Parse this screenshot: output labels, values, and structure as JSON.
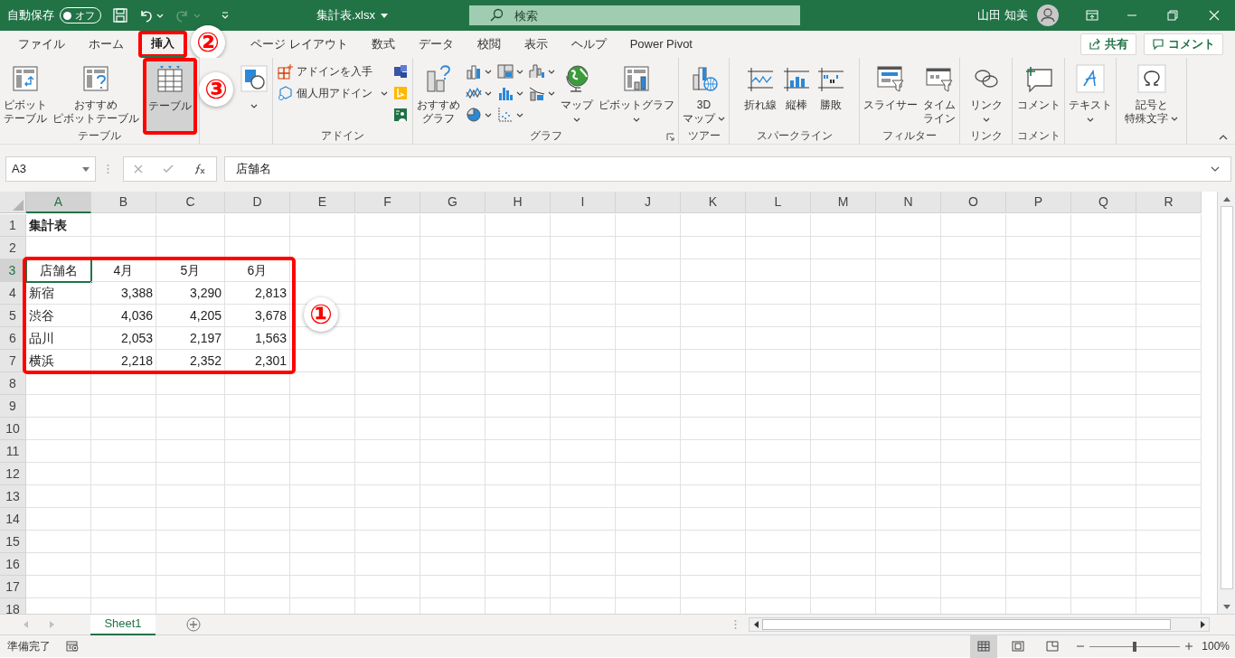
{
  "title_bar": {
    "autosave_label": "自動保存",
    "autosave_toggle": {
      "label": "オフ",
      "on": false
    },
    "redo_disabled": true,
    "file_name": "集計表.xlsx",
    "search_placeholder": "検索",
    "user_name": "山田 知美"
  },
  "ribbon_tabs": [
    {
      "label": "ファイル",
      "selected": false
    },
    {
      "label": "ホーム",
      "selected": false
    },
    {
      "label": "挿入",
      "selected": true
    },
    {
      "label": "ページ レイアウト",
      "selected": false
    },
    {
      "label": "数式",
      "selected": false
    },
    {
      "label": "データ",
      "selected": false
    },
    {
      "label": "校閲",
      "selected": false
    },
    {
      "label": "表示",
      "selected": false
    },
    {
      "label": "ヘルプ",
      "selected": false
    },
    {
      "label": "Power Pivot",
      "selected": false
    }
  ],
  "share_button": "共有",
  "comment_button": "コメント",
  "ribbon_groups": [
    {
      "label": "テーブル",
      "columns": [
        {
          "kind": "large",
          "lines": [
            "ピボット",
            "テーブル"
          ],
          "dropdown": false,
          "hovered": false
        },
        {
          "kind": "large",
          "lines": [
            "おすすめ",
            "ピボットテーブル"
          ],
          "dropdown": false,
          "hovered": false
        },
        {
          "kind": "large",
          "lines": [
            "テーブル"
          ],
          "dropdown": false,
          "hovered": true
        }
      ]
    },
    {
      "columns": [
        {
          "kind": "large",
          "dropdown": true,
          "hovered": false
        }
      ]
    },
    {
      "label": "アドイン",
      "columns": [
        {
          "kind": "stack",
          "items": [
            {
              "text": "アドインを入手",
              "dropdown": false
            },
            {
              "text": "個人用アドイン",
              "dropdown": true
            }
          ]
        },
        {
          "kind": "stack",
          "items": [
            {
              "dropdown": false
            },
            {
              "dropdown": false
            },
            {
              "dropdown": false
            }
          ]
        }
      ]
    },
    {
      "label": "グラフ",
      "launcher": true,
      "columns": [
        {
          "kind": "large",
          "lines": [
            "おすすめ",
            "グラフ"
          ],
          "dropdown": false,
          "hovered": false
        },
        {
          "kind": "stack",
          "items": [
            {
              "dropdown": true
            },
            {
              "dropdown": true
            },
            {
              "dropdown": true
            }
          ]
        },
        {
          "kind": "stack",
          "items": [
            {
              "dropdown": true
            },
            {
              "dropdown": true
            },
            {
              "dropdown": true
            }
          ]
        },
        {
          "kind": "stack",
          "items": [
            {
              "dropdown": true
            },
            {
              "dropdown": true
            }
          ]
        },
        {
          "kind": "large",
          "lines": [
            "マップ"
          ],
          "dropdown": true,
          "hovered": false
        },
        {
          "kind": "large",
          "lines": [
            "ピボットグラフ"
          ],
          "dropdown": true,
          "hovered": false
        }
      ]
    },
    {
      "label": "ツアー",
      "columns": [
        {
          "kind": "large",
          "lines": [
            "3D",
            "マップ"
          ],
          "dropdown": true,
          "hovered": false
        }
      ]
    },
    {
      "label": "スパークライン",
      "columns": [
        {
          "kind": "large",
          "lines": [
            "折れ線"
          ],
          "dropdown": false,
          "hovered": false
        },
        {
          "kind": "large",
          "lines": [
            "縦棒"
          ],
          "dropdown": false,
          "hovered": false
        },
        {
          "kind": "large",
          "lines": [
            "勝敗"
          ],
          "dropdown": false,
          "hovered": false
        }
      ]
    },
    {
      "label": "フィルター",
      "columns": [
        {
          "kind": "large",
          "lines": [
            "スライサー"
          ],
          "dropdown": false,
          "hovered": false
        },
        {
          "kind": "large",
          "lines": [
            "タイム",
            "ライン"
          ],
          "dropdown": false,
          "hovered": false
        }
      ]
    },
    {
      "label": "リンク",
      "columns": [
        {
          "kind": "large",
          "lines": [
            "リンク"
          ],
          "dropdown": true,
          "hovered": false
        }
      ]
    },
    {
      "label": "コメント",
      "columns": [
        {
          "kind": "large",
          "lines": [
            "コメント"
          ],
          "dropdown": false,
          "hovered": false
        }
      ]
    },
    {
      "columns": [
        {
          "kind": "large",
          "lines": [
            "テキスト"
          ],
          "dropdown": true,
          "hovered": false
        }
      ]
    },
    {
      "columns": [
        {
          "kind": "large",
          "lines": [
            "記号と",
            "特殊文字"
          ],
          "dropdown": true,
          "hovered": false
        }
      ]
    }
  ],
  "formula_bar": {
    "name_box": "A3",
    "formula": "店舗名"
  },
  "sheet": {
    "columns": [
      {
        "label": "A",
        "selected": true
      },
      {
        "label": "B",
        "selected": false
      },
      {
        "label": "C",
        "selected": false
      },
      {
        "label": "D",
        "selected": false
      },
      {
        "label": "E",
        "selected": false
      },
      {
        "label": "F",
        "selected": false
      },
      {
        "label": "G",
        "selected": false
      },
      {
        "label": "H",
        "selected": false
      },
      {
        "label": "I",
        "selected": false
      },
      {
        "label": "J",
        "selected": false
      },
      {
        "label": "K",
        "selected": false
      },
      {
        "label": "L",
        "selected": false
      },
      {
        "label": "M",
        "selected": false
      },
      {
        "label": "N",
        "selected": false
      },
      {
        "label": "O",
        "selected": false
      },
      {
        "label": "P",
        "selected": false
      },
      {
        "label": "Q",
        "selected": false
      },
      {
        "label": "R",
        "selected": false
      }
    ],
    "rows": [
      {
        "number": "1",
        "kind": "title",
        "selected": false,
        "cells": [
          "集計表"
        ]
      },
      {
        "number": "2",
        "selected": false
      },
      {
        "number": "3",
        "kind": "header",
        "selected": true,
        "cells": [
          "店舗名",
          "4月",
          "5月",
          "6月"
        ]
      },
      {
        "number": "4",
        "kind": "data",
        "selected": false,
        "cells": [
          "新宿",
          "3,388",
          "3,290",
          "2,813"
        ]
      },
      {
        "number": "5",
        "kind": "data",
        "selected": false,
        "cells": [
          "渋谷",
          "4,036",
          "4,205",
          "3,678"
        ]
      },
      {
        "number": "6",
        "kind": "data",
        "selected": false,
        "cells": [
          "品川",
          "2,053",
          "2,197",
          "1,563"
        ]
      },
      {
        "number": "7",
        "kind": "data",
        "selected": false,
        "cells": [
          "横浜",
          "2,218",
          "2,352",
          "2,301"
        ]
      },
      {
        "number": "8",
        "selected": false
      },
      {
        "number": "9",
        "selected": false
      },
      {
        "number": "10",
        "selected": false
      },
      {
        "number": "11",
        "selected": false
      },
      {
        "number": "12",
        "selected": false
      },
      {
        "number": "13",
        "selected": false
      },
      {
        "number": "14",
        "selected": false
      },
      {
        "number": "15",
        "selected": false
      },
      {
        "number": "16",
        "selected": false
      },
      {
        "number": "17",
        "selected": false
      },
      {
        "number": "18",
        "selected": false
      }
    ]
  },
  "sheet_tabs": [
    {
      "label": "Sheet1",
      "selected": true
    }
  ],
  "status_bar": {
    "text": "準備完了",
    "view_buttons": [
      {
        "selected": true
      },
      {
        "selected": false
      },
      {
        "selected": false
      }
    ],
    "zoom": {
      "level": 0.5,
      "label": "100%"
    }
  },
  "callouts": [
    {
      "label": "①"
    },
    {
      "label": "②"
    },
    {
      "label": "③"
    }
  ]
}
